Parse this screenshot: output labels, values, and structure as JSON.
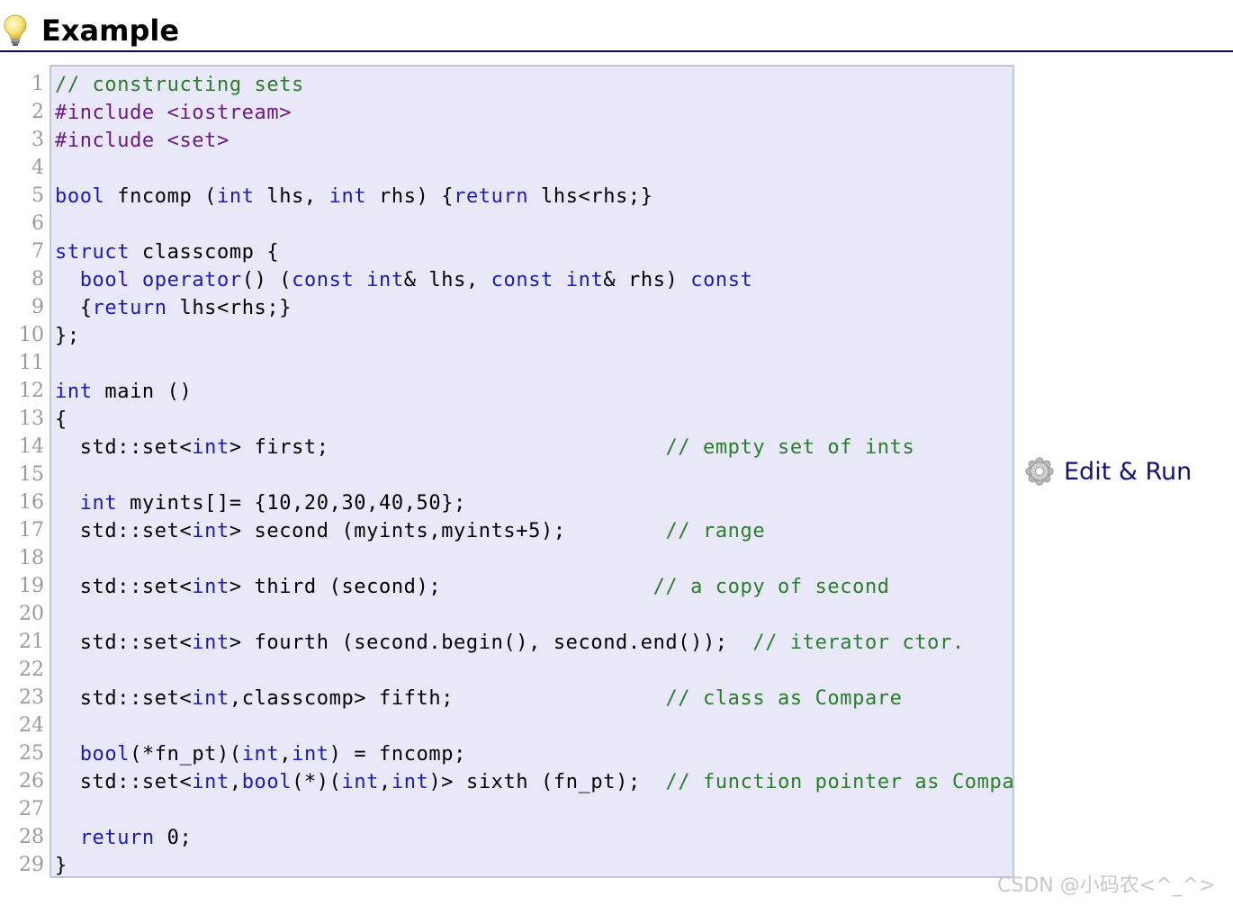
{
  "header": {
    "title": "Example"
  },
  "code": {
    "line_numbers": [
      "1",
      "2",
      "3",
      "4",
      "5",
      "6",
      "7",
      "8",
      "9",
      "10",
      "11",
      "12",
      "13",
      "14",
      "15",
      "16",
      "17",
      "18",
      "19",
      "20",
      "21",
      "22",
      "23",
      "24",
      "25",
      "26",
      "27",
      "28",
      "29"
    ],
    "lines": [
      [
        {
          "t": "// constructing sets",
          "c": "cm"
        }
      ],
      [
        {
          "t": "#include <iostream>",
          "c": "pp"
        }
      ],
      [
        {
          "t": "#include <set>",
          "c": "pp"
        }
      ],
      [],
      [
        {
          "t": "bool",
          "c": "kw"
        },
        {
          "t": " fncomp (",
          "c": "pl"
        },
        {
          "t": "int",
          "c": "kw"
        },
        {
          "t": " lhs, ",
          "c": "pl"
        },
        {
          "t": "int",
          "c": "kw"
        },
        {
          "t": " rhs) {",
          "c": "pl"
        },
        {
          "t": "return",
          "c": "kw"
        },
        {
          "t": " lhs<rhs;}",
          "c": "pl"
        }
      ],
      [],
      [
        {
          "t": "struct",
          "c": "kw"
        },
        {
          "t": " classcomp {",
          "c": "pl"
        }
      ],
      [
        {
          "t": "  ",
          "c": "pl"
        },
        {
          "t": "bool",
          "c": "kw"
        },
        {
          "t": " ",
          "c": "pl"
        },
        {
          "t": "operator",
          "c": "kw"
        },
        {
          "t": "() (",
          "c": "pl"
        },
        {
          "t": "const",
          "c": "kw"
        },
        {
          "t": " ",
          "c": "pl"
        },
        {
          "t": "int",
          "c": "kw"
        },
        {
          "t": "& lhs, ",
          "c": "pl"
        },
        {
          "t": "const",
          "c": "kw"
        },
        {
          "t": " ",
          "c": "pl"
        },
        {
          "t": "int",
          "c": "kw"
        },
        {
          "t": "& rhs) ",
          "c": "pl"
        },
        {
          "t": "const",
          "c": "kw"
        }
      ],
      [
        {
          "t": "  {",
          "c": "pl"
        },
        {
          "t": "return",
          "c": "kw"
        },
        {
          "t": " lhs<rhs;}",
          "c": "pl"
        }
      ],
      [
        {
          "t": "};",
          "c": "pl"
        }
      ],
      [],
      [
        {
          "t": "int",
          "c": "kw"
        },
        {
          "t": " main ()",
          "c": "pl"
        }
      ],
      [
        {
          "t": "{",
          "c": "pl"
        }
      ],
      [
        {
          "t": "  std::set<",
          "c": "pl"
        },
        {
          "t": "int",
          "c": "kw"
        },
        {
          "t": "> first;                           ",
          "c": "pl"
        },
        {
          "t": "// empty set of ints",
          "c": "cm"
        }
      ],
      [],
      [
        {
          "t": "  ",
          "c": "pl"
        },
        {
          "t": "int",
          "c": "kw"
        },
        {
          "t": " myints[]= {10,20,30,40,50};",
          "c": "pl"
        }
      ],
      [
        {
          "t": "  std::set<",
          "c": "pl"
        },
        {
          "t": "int",
          "c": "kw"
        },
        {
          "t": "> second (myints,myints+5);        ",
          "c": "pl"
        },
        {
          "t": "// range",
          "c": "cm"
        }
      ],
      [],
      [
        {
          "t": "  std::set<",
          "c": "pl"
        },
        {
          "t": "int",
          "c": "kw"
        },
        {
          "t": "> third (second);                 ",
          "c": "pl"
        },
        {
          "t": "// a copy of second",
          "c": "cm"
        }
      ],
      [],
      [
        {
          "t": "  std::set<",
          "c": "pl"
        },
        {
          "t": "int",
          "c": "kw"
        },
        {
          "t": "> fourth (second.begin(), second.end());  ",
          "c": "pl"
        },
        {
          "t": "// iterator ctor.",
          "c": "cm"
        }
      ],
      [],
      [
        {
          "t": "  std::set<",
          "c": "pl"
        },
        {
          "t": "int",
          "c": "kw"
        },
        {
          "t": ",classcomp> fifth;                 ",
          "c": "pl"
        },
        {
          "t": "// class as Compare",
          "c": "cm"
        }
      ],
      [],
      [
        {
          "t": "  ",
          "c": "pl"
        },
        {
          "t": "bool",
          "c": "kw"
        },
        {
          "t": "(*fn_pt)(",
          "c": "pl"
        },
        {
          "t": "int",
          "c": "kw"
        },
        {
          "t": ",",
          "c": "pl"
        },
        {
          "t": "int",
          "c": "kw"
        },
        {
          "t": ") = fncomp;",
          "c": "pl"
        }
      ],
      [
        {
          "t": "  std::set<",
          "c": "pl"
        },
        {
          "t": "int",
          "c": "kw"
        },
        {
          "t": ",",
          "c": "pl"
        },
        {
          "t": "bool",
          "c": "kw"
        },
        {
          "t": "(*)(",
          "c": "pl"
        },
        {
          "t": "int",
          "c": "kw"
        },
        {
          "t": ",",
          "c": "pl"
        },
        {
          "t": "int",
          "c": "kw"
        },
        {
          "t": ")> sixth (fn_pt);  ",
          "c": "pl"
        },
        {
          "t": "// function pointer as Compare",
          "c": "cm"
        }
      ],
      [],
      [
        {
          "t": "  ",
          "c": "pl"
        },
        {
          "t": "return",
          "c": "kw"
        },
        {
          "t": " 0;",
          "c": "pl"
        }
      ],
      [
        {
          "t": "}",
          "c": "pl"
        }
      ]
    ]
  },
  "actions": {
    "edit_run_label": "Edit & Run",
    "edit_run_icon": "gear-icon"
  },
  "watermark": {
    "text": "CSDN @小码农<^_^>"
  },
  "colors": {
    "comment": "#2a7d2a",
    "keyword": "#1c1cb0",
    "preprocessor": "#6a1a80",
    "code_background": "#e8e8f8",
    "link": "#12127a"
  }
}
